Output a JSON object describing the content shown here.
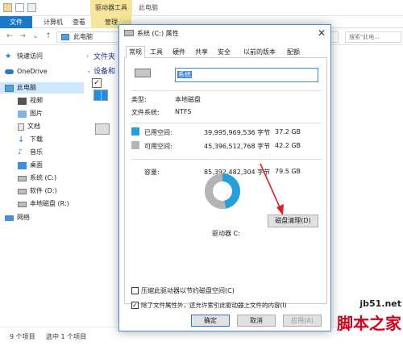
{
  "explorer": {
    "ribbon_context_title": "驱动器工具",
    "window_title": "此电脑",
    "tabs": [
      "文件",
      "计算机",
      "查看",
      "管理"
    ],
    "address": "此电脑",
    "search_placeholder": "搜索\"此电...",
    "nav": [
      {
        "label": "快速访问",
        "icon": "star-icon"
      },
      {
        "label": "OneDrive",
        "icon": "cloud-icon"
      },
      {
        "label": "此电脑",
        "icon": "computer-icon"
      },
      {
        "label": "视频",
        "icon": "video-icon"
      },
      {
        "label": "图片",
        "icon": "picture-icon"
      },
      {
        "label": "文档",
        "icon": "document-icon"
      },
      {
        "label": "下载",
        "icon": "download-icon"
      },
      {
        "label": "音乐",
        "icon": "music-icon"
      },
      {
        "label": "桌面",
        "icon": "desktop-icon"
      },
      {
        "label": "系统 (C:)",
        "icon": "drive-icon"
      },
      {
        "label": "软件 (D:)",
        "icon": "drive-icon"
      },
      {
        "label": "本地磁盘 (R:)",
        "icon": "drive-icon"
      },
      {
        "label": "网络",
        "icon": "network-icon"
      }
    ],
    "sections": [
      "文件夹",
      "设备和"
    ],
    "status_items": "9 个项目",
    "status_selected": "选中 1 个项目"
  },
  "dialog": {
    "title": "系统 (C:) 属性",
    "tabs": [
      "常规",
      "工具",
      "硬件",
      "共享",
      "安全",
      "以前的版本",
      "配额"
    ],
    "active_tab": "常规",
    "name_value": "系统",
    "type_label": "类型:",
    "type_value": "本地磁盘",
    "fs_label": "文件系统:",
    "fs_value": "NTFS",
    "used_label": "已用空间:",
    "used_bytes": "39,995,969,536 字节",
    "used_gb": "37.2 GB",
    "free_label": "可用空间:",
    "free_bytes": "45,396,512,768 字节",
    "free_gb": "42.2 GB",
    "capacity_label": "容量:",
    "capacity_bytes": "85,392,482,304 字节",
    "capacity_gb": "79.5 GB",
    "drive_label": "驱动器 C:",
    "cleanup_button": "磁盘清理(D)",
    "compress_label": "压缩此驱动器以节约磁盘空间(C)",
    "compress_checked": false,
    "index_label": "除了文件属性外，还允许索引此驱动器上文件的内容(I)",
    "index_checked": true,
    "ok": "确定",
    "cancel": "取消",
    "apply": "应用(A)",
    "used_fraction": 0.4684,
    "colors": {
      "used": "#26a0da",
      "free": "#b4b4b4",
      "arrow": "#e02020"
    }
  },
  "watermark": {
    "url": "jb51.net",
    "text": "脚本之家"
  }
}
